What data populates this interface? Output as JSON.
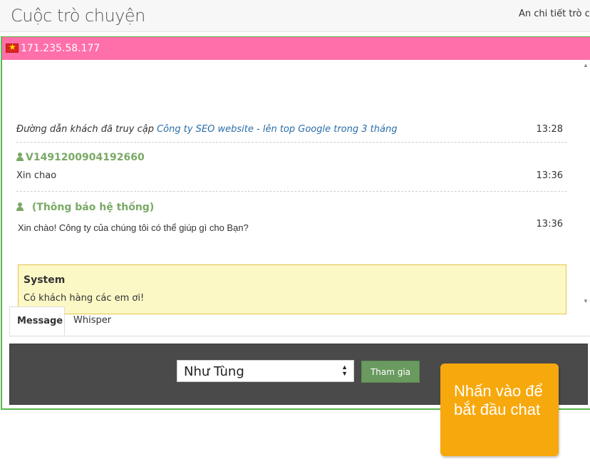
{
  "header": {
    "title": "Cuộc trò chuyện",
    "hide_details": "Ẩn chi tiết trò chuyện"
  },
  "visitor": {
    "ip": "171.235.58.177"
  },
  "messages": [
    {
      "kind": "path",
      "prefix": "Đường dẫn khách đã truy cập",
      "link": "Công ty SEO website - lên top Google trong 3 tháng",
      "time": "13:28"
    },
    {
      "kind": "user",
      "sender": "V1491200904192660",
      "text": "Xin chao",
      "time": "13:36"
    },
    {
      "kind": "system_notice",
      "sender": "(Thông báo hệ thống)",
      "text": "Xin chào! Công ty của chúng tôi có thể giúp gì cho Bạn?",
      "time": "13:36"
    }
  ],
  "system_box": {
    "title": "System",
    "text": "Có khách hàng các em ơi!"
  },
  "tabs": [
    {
      "label": "Message"
    },
    {
      "label": "Whisper"
    }
  ],
  "composer": {
    "agent_select": "Như Tùng",
    "join_label": "Tham gia"
  },
  "callout": {
    "text": "Nhấn vào để bắt đầu chat"
  },
  "colors": {
    "ip_bar": "#ff6fa9",
    "accent_green": "#58b64d",
    "sender_green": "#7aa965",
    "link_blue": "#2a6ea8",
    "callout": "#f7a80c"
  }
}
